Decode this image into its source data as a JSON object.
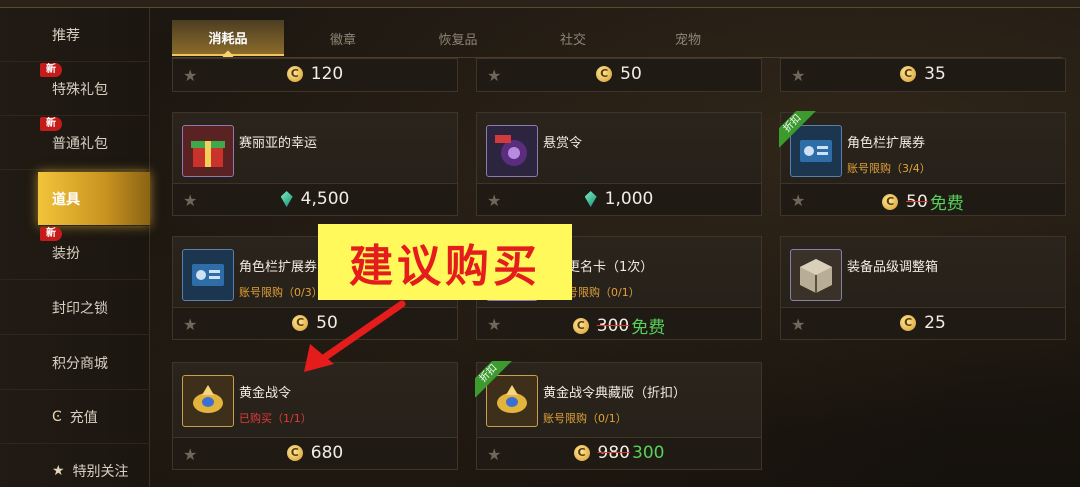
{
  "header": {
    "title": ""
  },
  "sidebar": {
    "items": [
      {
        "label": "推荐",
        "badge": ""
      },
      {
        "label": "特殊礼包",
        "badge": "新"
      },
      {
        "label": "普通礼包",
        "badge": "新"
      },
      {
        "label": "道具",
        "badge": "",
        "active": true
      },
      {
        "label": "装扮",
        "badge": "新"
      },
      {
        "label": "封印之锁",
        "badge": ""
      },
      {
        "label": "积分商城",
        "badge": ""
      },
      {
        "label": "充值",
        "badge": "",
        "icon": "coin-icon"
      },
      {
        "label": "特别关注",
        "badge": "",
        "icon": "star-icon"
      }
    ]
  },
  "tabs": [
    "消耗品",
    "徽章",
    "恢复品",
    "社交",
    "宠物"
  ],
  "active_tab": "消耗品",
  "cards": [
    {
      "name": "",
      "limit": "",
      "price": "120",
      "currency": "coin",
      "icon": "item-icon"
    },
    {
      "name": "",
      "limit": "",
      "price": "50",
      "currency": "coin",
      "icon": "item-icon"
    },
    {
      "name": "",
      "limit": "",
      "price": "35",
      "currency": "coin",
      "icon": "item-icon"
    },
    {
      "name": "赛丽亚的幸运",
      "limit": "",
      "price": "4,500",
      "currency": "gem",
      "icon": "gift-box-icon"
    },
    {
      "name": "悬赏令",
      "limit": "",
      "price": "1,000",
      "currency": "gem",
      "icon": "bounty-icon"
    },
    {
      "name": "角色栏扩展券",
      "limit": "账号限购（3/4）",
      "old_price": "50",
      "new_price": "免费",
      "currency": "coin",
      "discount": "折扣",
      "icon": "ticket-icon"
    },
    {
      "name": "角色栏扩展券",
      "limit": "账号限购（0/3）",
      "price": "50",
      "currency": "coin",
      "icon": "ticket-icon"
    },
    {
      "name": "更名卡（1次）",
      "limit": "号限购（0/1）",
      "old_price": "300",
      "new_price": "免费",
      "currency": "coin",
      "icon": "rename-card-icon"
    },
    {
      "name": "装备品级调整箱",
      "limit": "",
      "price": "25",
      "currency": "coin",
      "icon": "box-icon"
    },
    {
      "name": "黄金战令",
      "limit": "已购买（1/1）",
      "limit_style": "bought",
      "price": "680",
      "currency": "coin",
      "icon": "gold-pass-icon"
    },
    {
      "name": "黄金战令典藏版（折扣）",
      "limit": "账号限购（0/1）",
      "old_price": "980",
      "new_price": "300",
      "currency": "coin",
      "discount": "折扣",
      "icon": "gold-pass-icon"
    }
  ],
  "annotation": {
    "text": "建议购买",
    "color": "#e51c1c",
    "background": "#fff95b"
  },
  "colors": {
    "accent": "#f2c43a",
    "free": "#57d15a",
    "badge": "#c61b1b",
    "limit": "#e1a13a"
  }
}
